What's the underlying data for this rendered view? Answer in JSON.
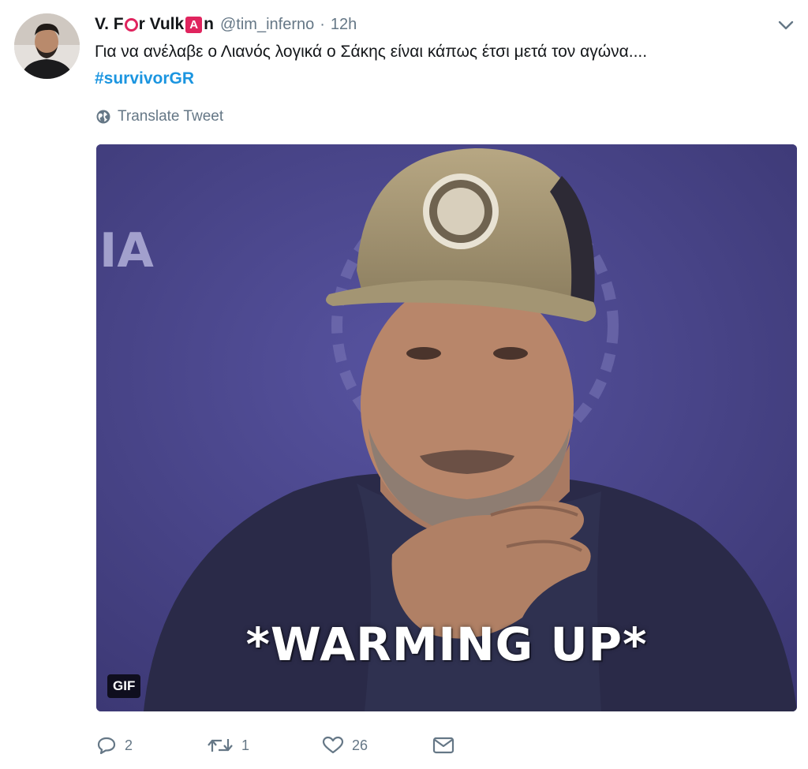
{
  "tweet": {
    "display_name": {
      "part1": "V. F",
      "part2": "r Vulk",
      "part3": "n",
      "boxed_letter": "A"
    },
    "handle": "@tim_inferno",
    "separator": "·",
    "time": "12h",
    "text": "Για να ανέλαβε ο Λιανός λογικά ο Σάκης είναι κάπως έτσι μετά τον αγώνα....",
    "hashtag": "#survivorGR",
    "translate_label": "Translate Tweet",
    "media": {
      "overlay_text": "*WARMING UP*",
      "badge": "GIF",
      "background_text": "IA"
    },
    "actions": {
      "reply_count": "2",
      "retweet_count": "1",
      "like_count": "26"
    }
  },
  "colors": {
    "accent_link": "#1b95e0",
    "muted_text": "#657786",
    "brand_highlight": "#e0245e",
    "media_background": "#4c4886"
  },
  "icons": {
    "caret": "chevron-down-icon",
    "translate": "globe-icon",
    "reply": "reply-icon",
    "retweet": "retweet-icon",
    "like": "heart-icon",
    "message": "envelope-icon"
  }
}
